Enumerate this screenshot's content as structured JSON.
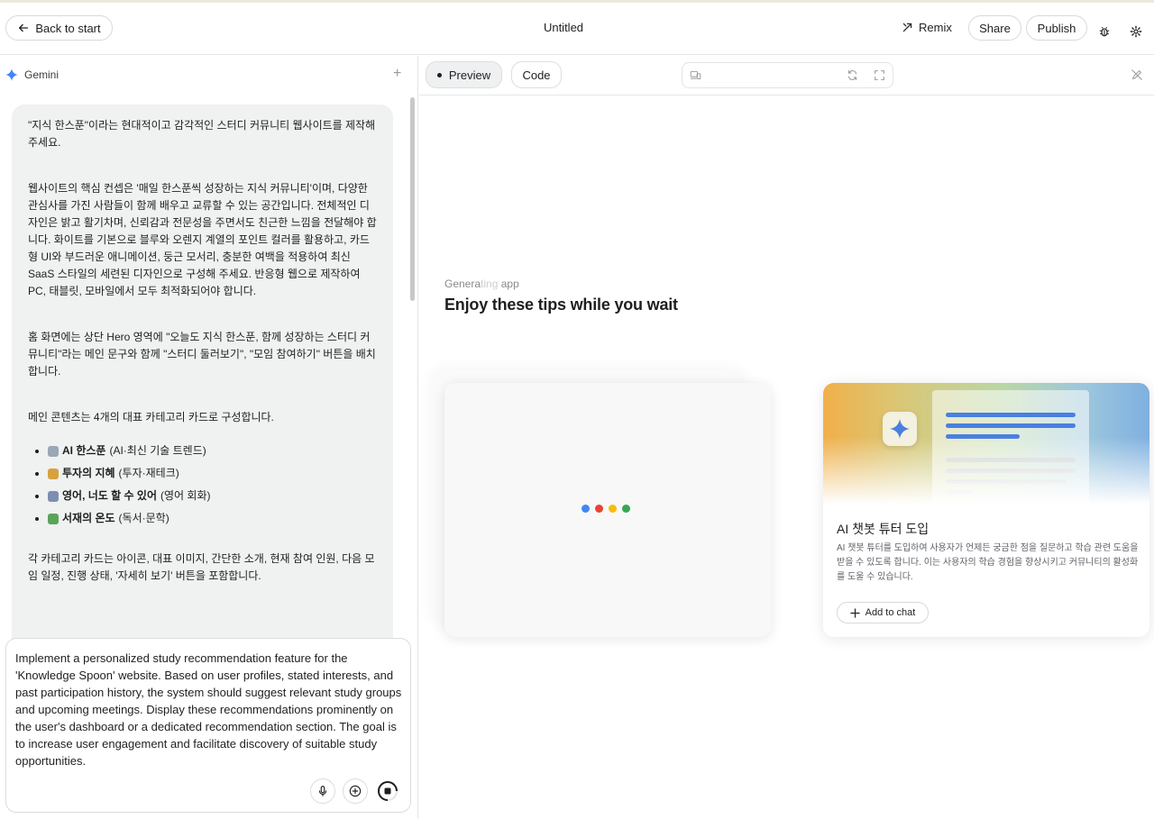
{
  "header": {
    "back_label": "Back to start",
    "title": "Untitled",
    "remix_label": "Remix",
    "share_label": "Share",
    "publish_label": "Publish"
  },
  "sidebar": {
    "model_name": "Gemini",
    "prompt_paragraphs": [
      "\"지식 한스푼\"이라는 현대적이고 감각적인 스터디 커뮤니티 웹사이트를 제작해 주세요.",
      "웹사이트의 핵심 컨셉은 '매일 한스푼씩 성장하는 지식 커뮤니티'이며, 다양한 관심사를 가진 사람들이 함께 배우고 교류할 수 있는 공간입니다. 전체적인 디자인은 밝고 활기차며, 신뢰감과 전문성을 주면서도 친근한 느낌을 전달해야 합니다. 화이트를 기본으로 블루와 오렌지 계열의 포인트 컬러를 활용하고, 카드형 UI와 부드러운 애니메이션, 둥근 모서리, 충분한 여백을 적용하여 최신 SaaS 스타일의 세련된 디자인으로 구성해 주세요. 반응형 웹으로 제작하여 PC, 태블릿, 모바일에서 모두 최적화되어야 합니다.",
      "홈 화면에는 상단 Hero 영역에 \"오늘도 지식 한스푼, 함께 성장하는 스터디 커뮤니티\"라는 메인 문구와 함께 \"스터디 둘러보기\", \"모임 참여하기\" 버튼을 배치합니다.",
      "메인 콘텐츠는 4개의 대표 카테고리 카드로 구성합니다."
    ],
    "categories": [
      {
        "name": "AI 한스푼",
        "desc": "(AI·최신 기술 트렌드)",
        "emoji_color": "#9aa7b4"
      },
      {
        "name": "투자의 지혜",
        "desc": "(투자·재테크)",
        "emoji_color": "#d7a23c"
      },
      {
        "name": "영어, 너도 할 수 있어",
        "desc": "(영어 회화)",
        "emoji_color": "#7c8fb0"
      },
      {
        "name": "서재의 온도",
        "desc": "(독서·문학)",
        "emoji_color": "#5aa35a"
      }
    ],
    "prompt_last": "각 카테고리 카드는 아이콘, 대표 이미지, 간단한 소개, 현재 참여 인원, 다음 모임 일정, 진행 상태, '자세히 보기' 버튼을 포함합니다.",
    "input_value": "Implement a personalized study recommendation feature for the 'Knowledge Spoon' website. Based on user profiles, stated interests, and past participation history, the system should suggest relevant study groups and upcoming meetings. Display these recommendations prominently on the user's dashboard or a dedicated recommendation section. The goal is to increase user engagement and facilitate discovery of suitable study opportunities."
  },
  "preview": {
    "tab_preview": "Preview",
    "tab_code": "Code",
    "generating_visible": "Genera",
    "generating_faded": "ting",
    "generating_tail": " app",
    "headline": "Enjoy these tips while you wait",
    "loader_colors": [
      "#4285f4",
      "#ea4335",
      "#fbbc04",
      "#34a853"
    ],
    "tip": {
      "title": "AI 챗봇 튜터 도입",
      "description": "AI 챗봇 튜터를 도입하여 사용자가 언제든 궁금한 점을 질문하고 학습 관련 도움을 받을 수 있도록 합니다. 이는 사용자의 학습 경험을 향상시키고 커뮤니티의 활성화를 도울 수 있습니다.",
      "button": "Add to chat"
    }
  },
  "colors": {
    "gemini_blue": "#4285f4",
    "border": "#dcdcdc",
    "message_bg": "#f0f1f1"
  }
}
